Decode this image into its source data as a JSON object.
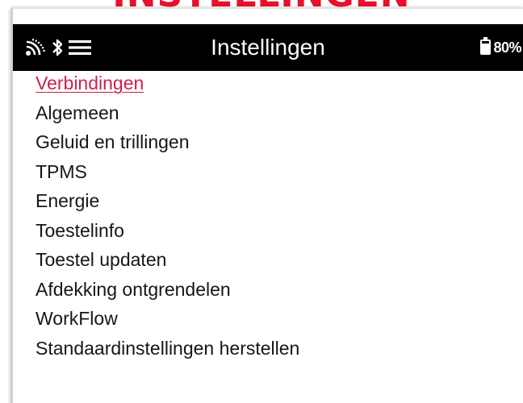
{
  "banner": {
    "title": "INSTELLINGEN"
  },
  "status_bar": {
    "title": "Instellingen",
    "icons": [
      "signal-icon",
      "bluetooth-icon",
      "hamburger-menu-icon"
    ],
    "battery_icon": "battery-icon",
    "battery_percent": "80%"
  },
  "menu": {
    "selected_index": 0,
    "items": [
      {
        "label": "Verbindingen"
      },
      {
        "label": "Algemeen"
      },
      {
        "label": "Geluid en trillingen"
      },
      {
        "label": "TPMS"
      },
      {
        "label": "Energie"
      },
      {
        "label": "Toestelinfo"
      },
      {
        "label": "Toestel updaten"
      },
      {
        "label": "Afdekking ontgrendelen"
      },
      {
        "label": "WorkFlow"
      },
      {
        "label": "Standaardinstellingen herstellen"
      }
    ]
  },
  "colors": {
    "banner_red": "#e8102a",
    "selected_item": "#c8234a",
    "status_bar_bg": "#000000",
    "text": "#161616"
  }
}
